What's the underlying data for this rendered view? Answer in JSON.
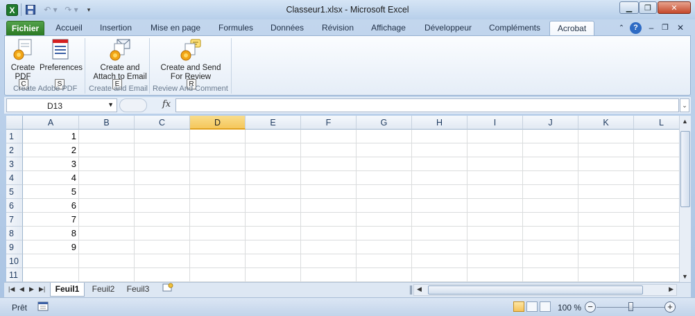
{
  "window": {
    "title": "Classeur1.xlsx - Microsoft Excel",
    "minimize": "▁",
    "restore": "❐",
    "close": "✕"
  },
  "tabs": [
    {
      "label": "Fichier"
    },
    {
      "label": "Accueil"
    },
    {
      "label": "Insertion"
    },
    {
      "label": "Mise en page"
    },
    {
      "label": "Formules"
    },
    {
      "label": "Données"
    },
    {
      "label": "Révision"
    },
    {
      "label": "Affichage"
    },
    {
      "label": "Développeur"
    },
    {
      "label": "Compléments"
    },
    {
      "label": "Acrobat"
    }
  ],
  "ribbon": {
    "create_pdf": {
      "line1": "Create",
      "line2": "PDF",
      "keytip": "C"
    },
    "preferences": {
      "label": "Preferences",
      "keytip": "S"
    },
    "create_attach": {
      "line1": "Create and",
      "line2": "Attach to Email",
      "keytip": "E"
    },
    "create_send": {
      "line1": "Create and Send",
      "line2": "For Review",
      "keytip": "R"
    },
    "groups": [
      "Create Adobe PDF",
      "Create and Email",
      "Review And Comment"
    ]
  },
  "formula_bar": {
    "name_box": "D13",
    "fx": "fx",
    "formula": ""
  },
  "sheet": {
    "columns": [
      "A",
      "B",
      "C",
      "D",
      "E",
      "F",
      "G",
      "H",
      "I",
      "J",
      "K",
      "L"
    ],
    "selected_column": "D",
    "rows": [
      "1",
      "2",
      "3",
      "4",
      "5",
      "6",
      "7",
      "8",
      "9",
      "10",
      "11"
    ],
    "column_a_values": [
      "1",
      "2",
      "3",
      "4",
      "5",
      "6",
      "7",
      "8",
      "9",
      "",
      ""
    ]
  },
  "sheet_tabs": [
    {
      "label": "Feuil1",
      "active": true
    },
    {
      "label": "Feuil2",
      "active": false
    },
    {
      "label": "Feuil3",
      "active": false
    }
  ],
  "status": {
    "ready": "Prêt",
    "zoom": "100 %",
    "zoom_level": 1.0
  },
  "colors": {
    "fichier_green": "#2b7a24",
    "selected_header": "#f5c75b",
    "ribbon_bg": "#e5edf7"
  }
}
